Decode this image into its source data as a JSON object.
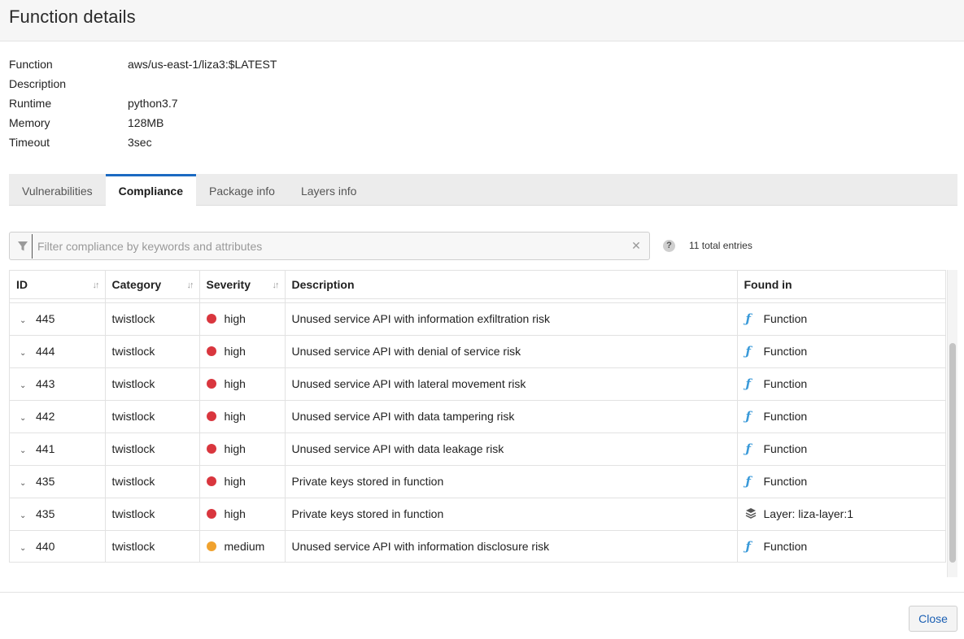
{
  "dialog": {
    "title": "Function details"
  },
  "details": [
    {
      "key": "Function",
      "value": "aws/us-east-1/liza3:$LATEST"
    },
    {
      "key": "Description",
      "value": ""
    },
    {
      "key": "Runtime",
      "value": "python3.7"
    },
    {
      "key": "Memory",
      "value": "128MB"
    },
    {
      "key": "Timeout",
      "value": "3sec"
    }
  ],
  "tabs": [
    {
      "label": "Vulnerabilities",
      "active": false
    },
    {
      "label": "Compliance",
      "active": true
    },
    {
      "label": "Package info",
      "active": false
    },
    {
      "label": "Layers info",
      "active": false
    }
  ],
  "filter": {
    "placeholder": "Filter compliance by keywords and attributes",
    "value": "",
    "clear_icon": "close-icon",
    "filter_icon": "funnel-icon"
  },
  "help_icon": "?",
  "total_entries": "11 total entries",
  "table": {
    "columns": [
      "ID",
      "Category",
      "Severity",
      "Description",
      "Found in"
    ],
    "rows": [
      {
        "id": "445",
        "category": "twistlock",
        "severity": "high",
        "description": "Unused service API with information exfiltration risk",
        "found_in": "Function",
        "found_icon": "function-icon"
      },
      {
        "id": "444",
        "category": "twistlock",
        "severity": "high",
        "description": "Unused service API with denial of service risk",
        "found_in": "Function",
        "found_icon": "function-icon"
      },
      {
        "id": "443",
        "category": "twistlock",
        "severity": "high",
        "description": "Unused service API with lateral movement risk",
        "found_in": "Function",
        "found_icon": "function-icon"
      },
      {
        "id": "442",
        "category": "twistlock",
        "severity": "high",
        "description": "Unused service API with data tampering risk",
        "found_in": "Function",
        "found_icon": "function-icon"
      },
      {
        "id": "441",
        "category": "twistlock",
        "severity": "high",
        "description": "Unused service API with data leakage risk",
        "found_in": "Function",
        "found_icon": "function-icon"
      },
      {
        "id": "435",
        "category": "twistlock",
        "severity": "high",
        "description": "Private keys stored in function",
        "found_in": "Function",
        "found_icon": "function-icon"
      },
      {
        "id": "435",
        "category": "twistlock",
        "severity": "high",
        "description": "Private keys stored in function",
        "found_in": "Layer: liza-layer:1",
        "found_icon": "layers-icon"
      },
      {
        "id": "440",
        "category": "twistlock",
        "severity": "medium",
        "description": "Unused service API with information disclosure risk",
        "found_in": "Function",
        "found_icon": "function-icon"
      }
    ]
  },
  "severity_colors": {
    "high": "#d9363e",
    "medium": "#f0a22e"
  },
  "footer": {
    "close_label": "Close"
  }
}
